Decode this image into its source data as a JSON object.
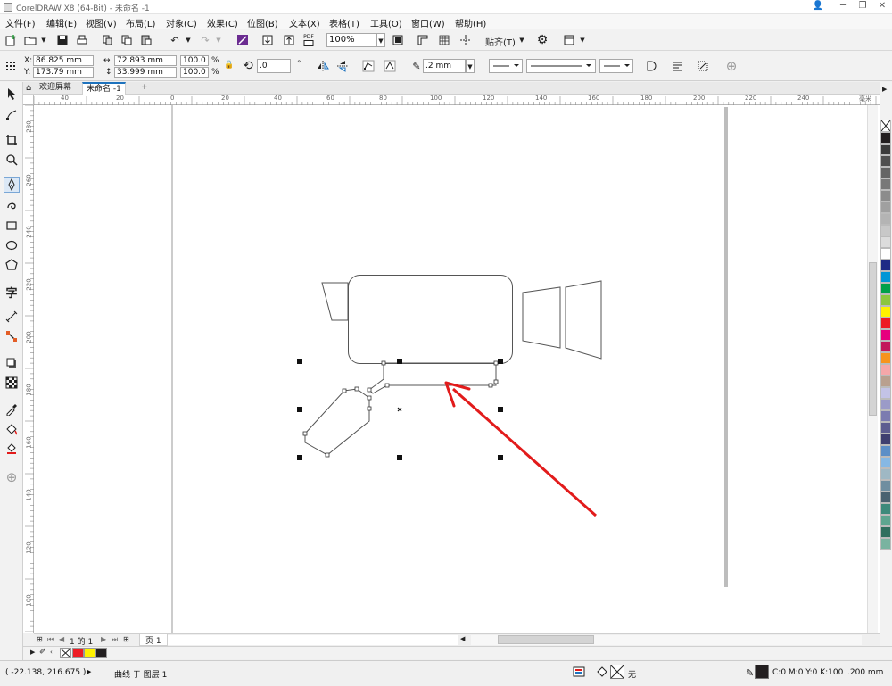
{
  "window": {
    "title": "CorelDRAW X8 (64-Bit) - 未命名 -1",
    "minimize": "─",
    "restore": "❐",
    "close": "✕"
  },
  "menu": [
    "文件(F)",
    "编辑(E)",
    "视图(V)",
    "布局(L)",
    "对象(C)",
    "效果(C)",
    "位图(B)",
    "文本(X)",
    "表格(T)",
    "工具(O)",
    "窗口(W)",
    "帮助(H)"
  ],
  "standard_toolbar": {
    "pdf_label": "PDF",
    "zoom_value": "100%",
    "snap_label": "贴齐(T)"
  },
  "property_bar": {
    "x_label": "X:",
    "x_value": "86.825 mm",
    "y_label": "Y:",
    "y_value": "173.79 mm",
    "width_value": "72.893 mm",
    "height_value": "33.999 mm",
    "scale_w": "100.0",
    "scale_h": "100.0",
    "percent": "%",
    "rotation": ".0",
    "degree": "°",
    "outline_width": ".2 mm"
  },
  "tabs": {
    "welcome": "欢迎屏幕",
    "document": "未命名 -1",
    "add": "+"
  },
  "ruler": {
    "h_labels": [
      "40",
      "20",
      "0",
      "20",
      "40",
      "60",
      "80",
      "100",
      "120",
      "140",
      "160",
      "180",
      "200",
      "220",
      "240"
    ],
    "v_labels": [
      "280",
      "260",
      "240",
      "220",
      "200",
      "180",
      "160",
      "140",
      "120",
      "100"
    ],
    "unit": "毫米"
  },
  "page_nav": {
    "page_count": "1 的 1",
    "page_tab": "页 1"
  },
  "status": {
    "coords": "( -22.138, 216.675 )",
    "object_info": "曲线 于 图层 1",
    "fill_none": "无",
    "outline_color": "C:0 M:0 Y:0 K:100",
    "outline_width": ".200 mm"
  },
  "colors": {
    "accent": "#1e73be",
    "arrow": "#e21b1b",
    "palette": [
      "#231f20",
      "#3b3b3b",
      "#505050",
      "#646464",
      "#787878",
      "#8c8c8c",
      "#a0a0a0",
      "#b4b4b4",
      "#c8c8c8",
      "#dcdcdc",
      "#ffffff",
      "#1f2a85",
      "#0096d6",
      "#00a04a",
      "#8dc63f",
      "#fff200",
      "#ed1c24",
      "#e6007e",
      "#c2185b",
      "#f7941d",
      "#f5a7a9",
      "#b9a08f",
      "#c3c3e6",
      "#9b9bc8",
      "#7c7cb0",
      "#5e5e90",
      "#404070",
      "#5d8fc7",
      "#86b8e4",
      "#9fb8c4",
      "#6f8ea0",
      "#4a6270",
      "#3d8a7b",
      "#5ea590",
      "#2f6e5e",
      "#7ab3a0"
    ],
    "doc_palette": [
      "#ed1c24",
      "#fff200",
      "#231f20"
    ]
  }
}
